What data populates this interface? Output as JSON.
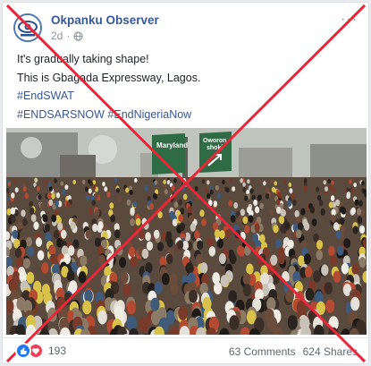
{
  "post": {
    "page_name": "Okpanku Observer",
    "time": "2d",
    "privacy_icon": "globe-icon",
    "lines": [
      "It's gradually taking shape!",
      "This is Gbagada Expressway, Lagos."
    ],
    "hashtags_line1": "#EndSWAT",
    "hashtags_line2": "#ENDSARSNOW #EndNigeriaNow",
    "photo": {
      "sign_left": "Maryland",
      "sign_right_line1": "Oworon",
      "sign_right_line2": "shoki"
    }
  },
  "footer": {
    "reaction_count": "193",
    "comments": "63 Comments",
    "shares": "624 Shares"
  },
  "overlay": {
    "color": "#e8283a"
  }
}
